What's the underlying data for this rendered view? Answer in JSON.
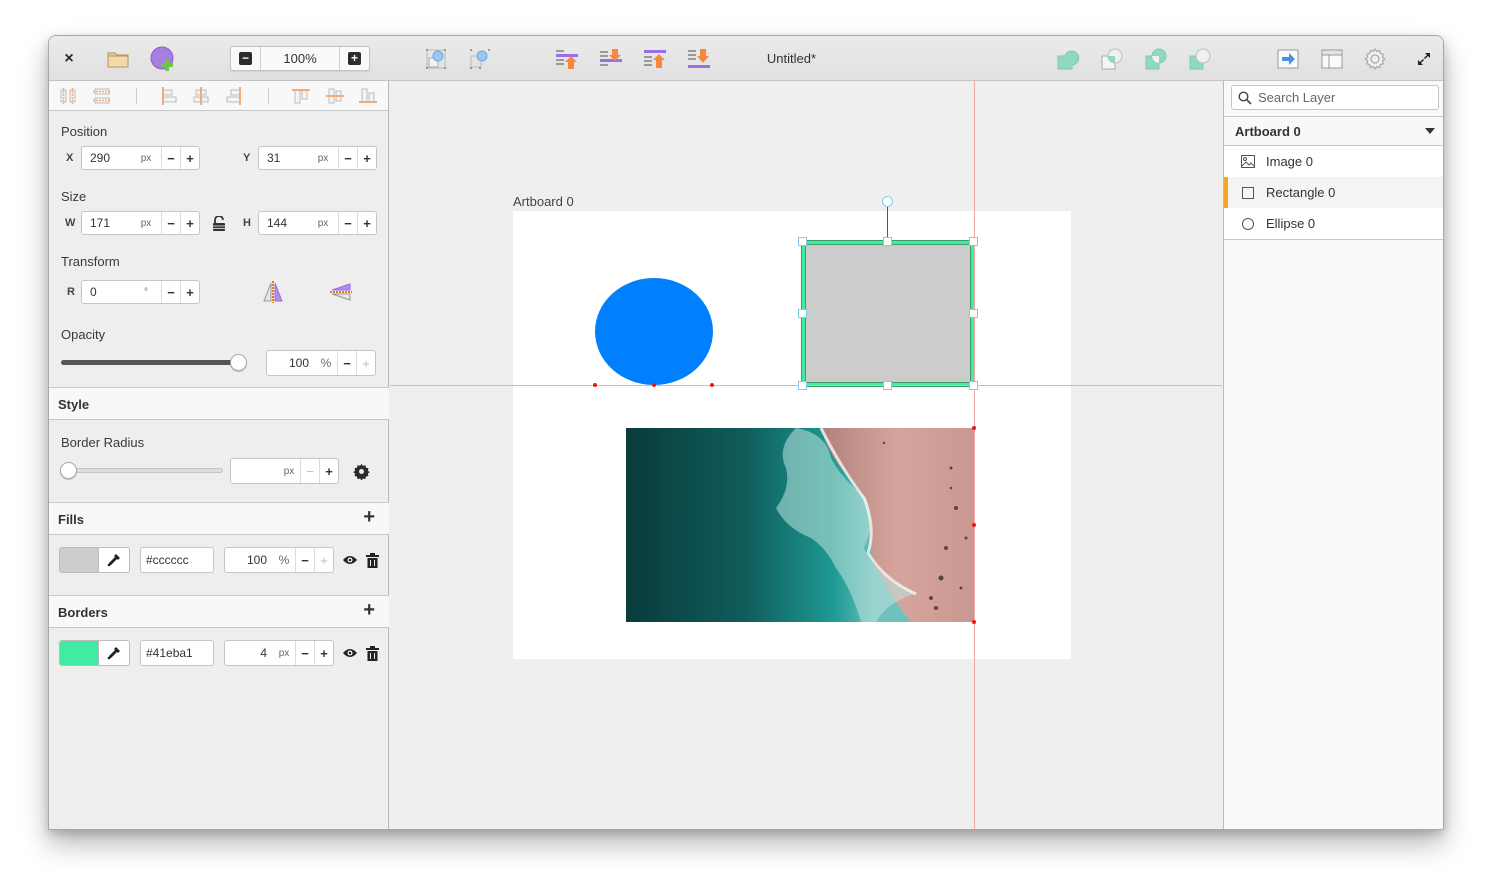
{
  "window": {
    "title": "Untitled*",
    "close_label": "×"
  },
  "toolbar": {
    "zoom_level": "100%",
    "zoom_out_symbol": "−",
    "zoom_in_symbol": "+",
    "left_icons": [
      "close-icon",
      "open-folder-icon",
      "new-artboard-icon"
    ],
    "selection_icons": [
      "group-selection-icon",
      "ungroup-selection-icon"
    ],
    "arrange_icons": [
      "raise-layer-icon",
      "lower-layer-icon",
      "bring-to-front-icon",
      "send-to-back-icon"
    ],
    "boolean_icons": [
      "union-icon",
      "subtract-icon",
      "intersect-icon",
      "difference-icon"
    ],
    "right_icons": [
      "export-icon",
      "layout-toggle-icon",
      "preferences-gear-icon",
      "fullscreen-icon"
    ]
  },
  "properties": {
    "align_tools": [
      "align-horizontal-spacing",
      "align-vertical-spacing",
      "align-left",
      "align-center",
      "align-right",
      "align-top",
      "align-middle",
      "align-bottom"
    ],
    "position": {
      "label": "Position",
      "x_label": "X",
      "x_value": "290",
      "x_unit": "px",
      "y_label": "Y",
      "y_value": "31",
      "y_unit": "px"
    },
    "size": {
      "label": "Size",
      "w_label": "W",
      "w_value": "171",
      "w_unit": "px",
      "h_label": "H",
      "h_value": "144",
      "h_unit": "px",
      "ratio_locked": false
    },
    "transform": {
      "label": "Transform",
      "r_label": "R",
      "r_value": "0",
      "r_unit": "°"
    },
    "opacity": {
      "label": "Opacity",
      "value": "100",
      "unit": "%",
      "slider_fraction": 1.0
    },
    "style": {
      "label": "Style",
      "border_radius_label": "Border Radius",
      "border_radius_value": "",
      "border_radius_unit": "px",
      "slider_fraction": 0.0
    },
    "fills": {
      "label": "Fills",
      "add_symbol": "+",
      "items": [
        {
          "color": "#cccccc",
          "hex": "#cccccc",
          "opacity": "100",
          "unit": "%"
        }
      ]
    },
    "borders": {
      "label": "Borders",
      "add_symbol": "+",
      "items": [
        {
          "color": "#41eba1",
          "hex": "#41eba1",
          "width": "4",
          "unit": "px"
        }
      ]
    },
    "step_minus": "−",
    "step_plus": "+"
  },
  "canvas": {
    "artboard_label": "Artboard 0",
    "ellipse_color": "#0080ff",
    "rectangle_fill": "#cccccc",
    "rectangle_border": "#41eba1",
    "guide_color": "#f7a9a9",
    "selection_handle_color": "#7ccfe8"
  },
  "layers": {
    "search_placeholder": "Search Layer",
    "artboard_name": "Artboard 0",
    "items": [
      {
        "name": "Image 0",
        "icon": "image-icon",
        "selected": false
      },
      {
        "name": "Rectangle 0",
        "icon": "rectangle-icon",
        "selected": true
      },
      {
        "name": "Ellipse 0",
        "icon": "ellipse-icon",
        "selected": false
      }
    ],
    "accent_color": "#f5a623"
  }
}
